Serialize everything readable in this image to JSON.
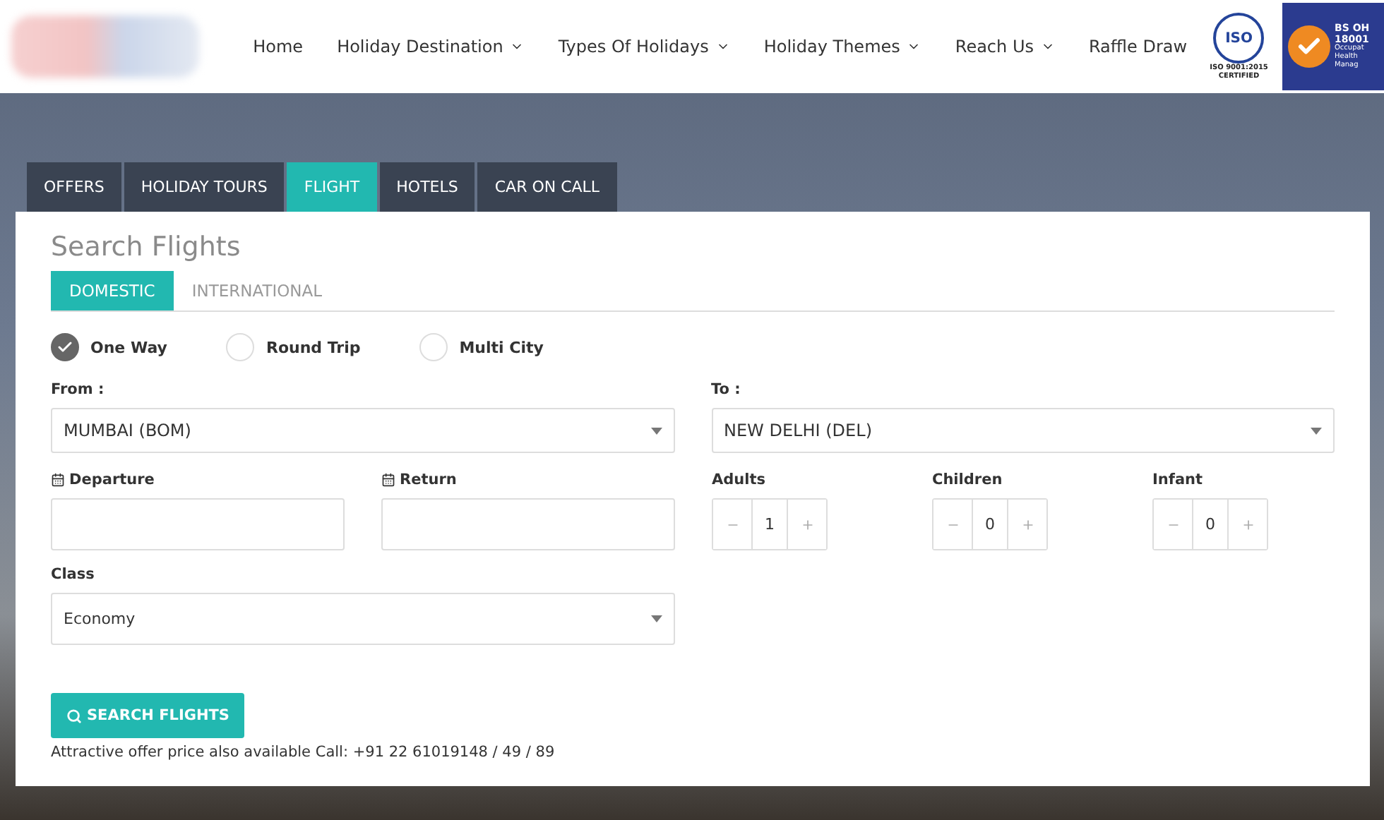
{
  "nav": [
    {
      "label": "Home",
      "dropdown": false
    },
    {
      "label": "Holiday Destination",
      "dropdown": true
    },
    {
      "label": "Types Of Holidays",
      "dropdown": true
    },
    {
      "label": "Holiday Themes",
      "dropdown": true
    },
    {
      "label": "Reach Us",
      "dropdown": true
    },
    {
      "label": "Raffle Draw",
      "dropdown": false
    }
  ],
  "badges": {
    "iso": {
      "mark": "ISO",
      "line1": "ISO 9001:2015",
      "line2": "CERTIFIED"
    },
    "bs": {
      "lines": [
        "BS OH",
        "18001",
        "Occupat",
        "Health",
        "Manag"
      ]
    }
  },
  "tabs": [
    {
      "label": "OFFERS",
      "selected": false
    },
    {
      "label": "HOLIDAY TOURS",
      "selected": false
    },
    {
      "label": "FLIGHT",
      "selected": true
    },
    {
      "label": "HOTELS",
      "selected": false
    },
    {
      "label": "CAR ON CALL",
      "selected": false
    }
  ],
  "panel": {
    "title": "Search Flights",
    "subtabs": [
      {
        "label": "DOMESTIC",
        "selected": true
      },
      {
        "label": "INTERNATIONAL",
        "selected": false
      }
    ],
    "trip_types": [
      {
        "label": "One Way",
        "selected": true
      },
      {
        "label": "Round Trip",
        "selected": false
      },
      {
        "label": "Multi City",
        "selected": false
      }
    ],
    "from": {
      "label": "From :",
      "value": "MUMBAI (BOM)"
    },
    "to": {
      "label": "To :",
      "value": "NEW DELHI (DEL)"
    },
    "departure": {
      "label": "Departure"
    },
    "return": {
      "label": "Return"
    },
    "counters": [
      {
        "label": "Adults",
        "value": "1"
      },
      {
        "label": "Children",
        "value": "0"
      },
      {
        "label": "Infant",
        "value": "0"
      }
    ],
    "class": {
      "label": "Class",
      "value": "Economy"
    },
    "search_button": "SEARCH FLIGHTS",
    "note": "Attractive offer price also available Call: +91 22 61019148 / 49 / 89"
  }
}
